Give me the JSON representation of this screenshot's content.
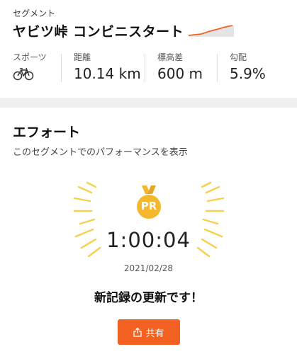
{
  "segment": {
    "label": "セグメント",
    "name": "ヤビツ峠 コンビニスタート"
  },
  "stats": [
    {
      "label": "スポーツ",
      "icon": "bicycle-icon"
    },
    {
      "label": "距離",
      "value": "10.14 km"
    },
    {
      "label": "標高差",
      "value": "600 m"
    },
    {
      "label": "勾配",
      "value": "5.9%"
    }
  ],
  "effort": {
    "title": "エフォート",
    "subtitle": "このセグメントでのパフォーマンスを表示",
    "badge": "PR",
    "time": "1:00:04",
    "date": "2021/02/28",
    "message": "新記録の更新です！",
    "share_label": "共有"
  },
  "colors": {
    "accent": "#f26122",
    "medal": "#f5b72e",
    "rays": "#f7cf4f"
  }
}
